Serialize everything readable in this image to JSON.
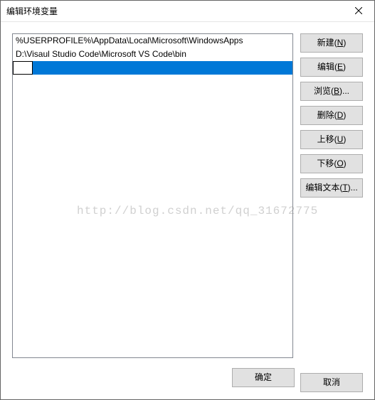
{
  "window": {
    "title": "编辑环境变量"
  },
  "list": {
    "items": [
      {
        "text": "%USERPROFILE%\\AppData\\Local\\Microsoft\\WindowsApps",
        "selected": false,
        "editing": false
      },
      {
        "text": "D:\\Visaul Studio Code\\Microsoft VS Code\\bin",
        "selected": false,
        "editing": false
      },
      {
        "text": "",
        "selected": true,
        "editing": true
      }
    ]
  },
  "buttons": {
    "new_label": "新建",
    "new_key": "N",
    "edit_label": "编辑",
    "edit_key": "E",
    "browse_label": "浏览",
    "browse_key": "B",
    "browse_suffix": "...",
    "delete_label": "删除",
    "delete_key": "D",
    "moveup_label": "上移",
    "moveup_key": "U",
    "movedown_label": "下移",
    "movedown_key": "O",
    "edittext_label": "编辑文本",
    "edittext_key": "T",
    "edittext_suffix": "...",
    "ok": "确定",
    "cancel": "取消"
  },
  "watermark": "http://blog.csdn.net/qq_31672775"
}
